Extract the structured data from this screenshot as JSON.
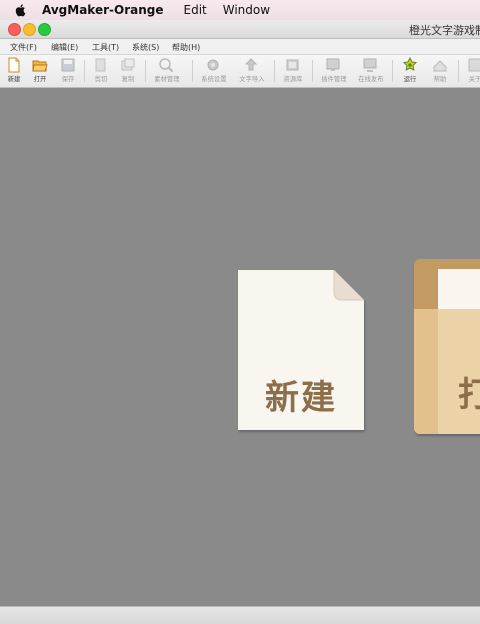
{
  "menubar": {
    "app_name": "AvgMaker-Orange",
    "items": [
      "Edit",
      "Window"
    ]
  },
  "window": {
    "title": "橙光文字游戏制"
  },
  "app_menu": [
    {
      "label": "文件(F)"
    },
    {
      "label": "编辑(E)"
    },
    {
      "label": "工具(T)"
    },
    {
      "label": "系统(S)"
    },
    {
      "label": "帮助(H)"
    }
  ],
  "toolbar": [
    {
      "label": "新建",
      "icon": "new-file-icon",
      "enabled": true
    },
    {
      "label": "打开",
      "icon": "open-folder-icon",
      "enabled": true
    },
    {
      "label": "保存",
      "icon": "save-icon",
      "enabled": false
    },
    {
      "label": "剪切",
      "icon": "cut-icon",
      "enabled": false
    },
    {
      "label": "复制",
      "icon": "copy-icon",
      "enabled": false
    },
    {
      "label": "素材管理",
      "icon": "material-manager-icon",
      "enabled": false
    },
    {
      "label": "系统设置",
      "icon": "system-settings-icon",
      "enabled": false
    },
    {
      "label": "文字导入",
      "icon": "text-import-icon",
      "enabled": false
    },
    {
      "label": "资源库",
      "icon": "resource-library-icon",
      "enabled": false
    },
    {
      "label": "插件管理",
      "icon": "plugin-manager-icon",
      "enabled": false
    },
    {
      "label": "在线发布",
      "icon": "publish-icon",
      "enabled": false
    },
    {
      "label": "运行",
      "icon": "run-icon",
      "enabled": true
    },
    {
      "label": "帮助",
      "icon": "help-icon",
      "enabled": false
    },
    {
      "label": "关于",
      "icon": "about-icon",
      "enabled": false
    }
  ],
  "start": {
    "new_label": "新建",
    "open_label": "打"
  },
  "colors": {
    "canvas": "#8a8a8a",
    "card_text": "#8d6e4a",
    "open_folder": "#c49a63"
  }
}
